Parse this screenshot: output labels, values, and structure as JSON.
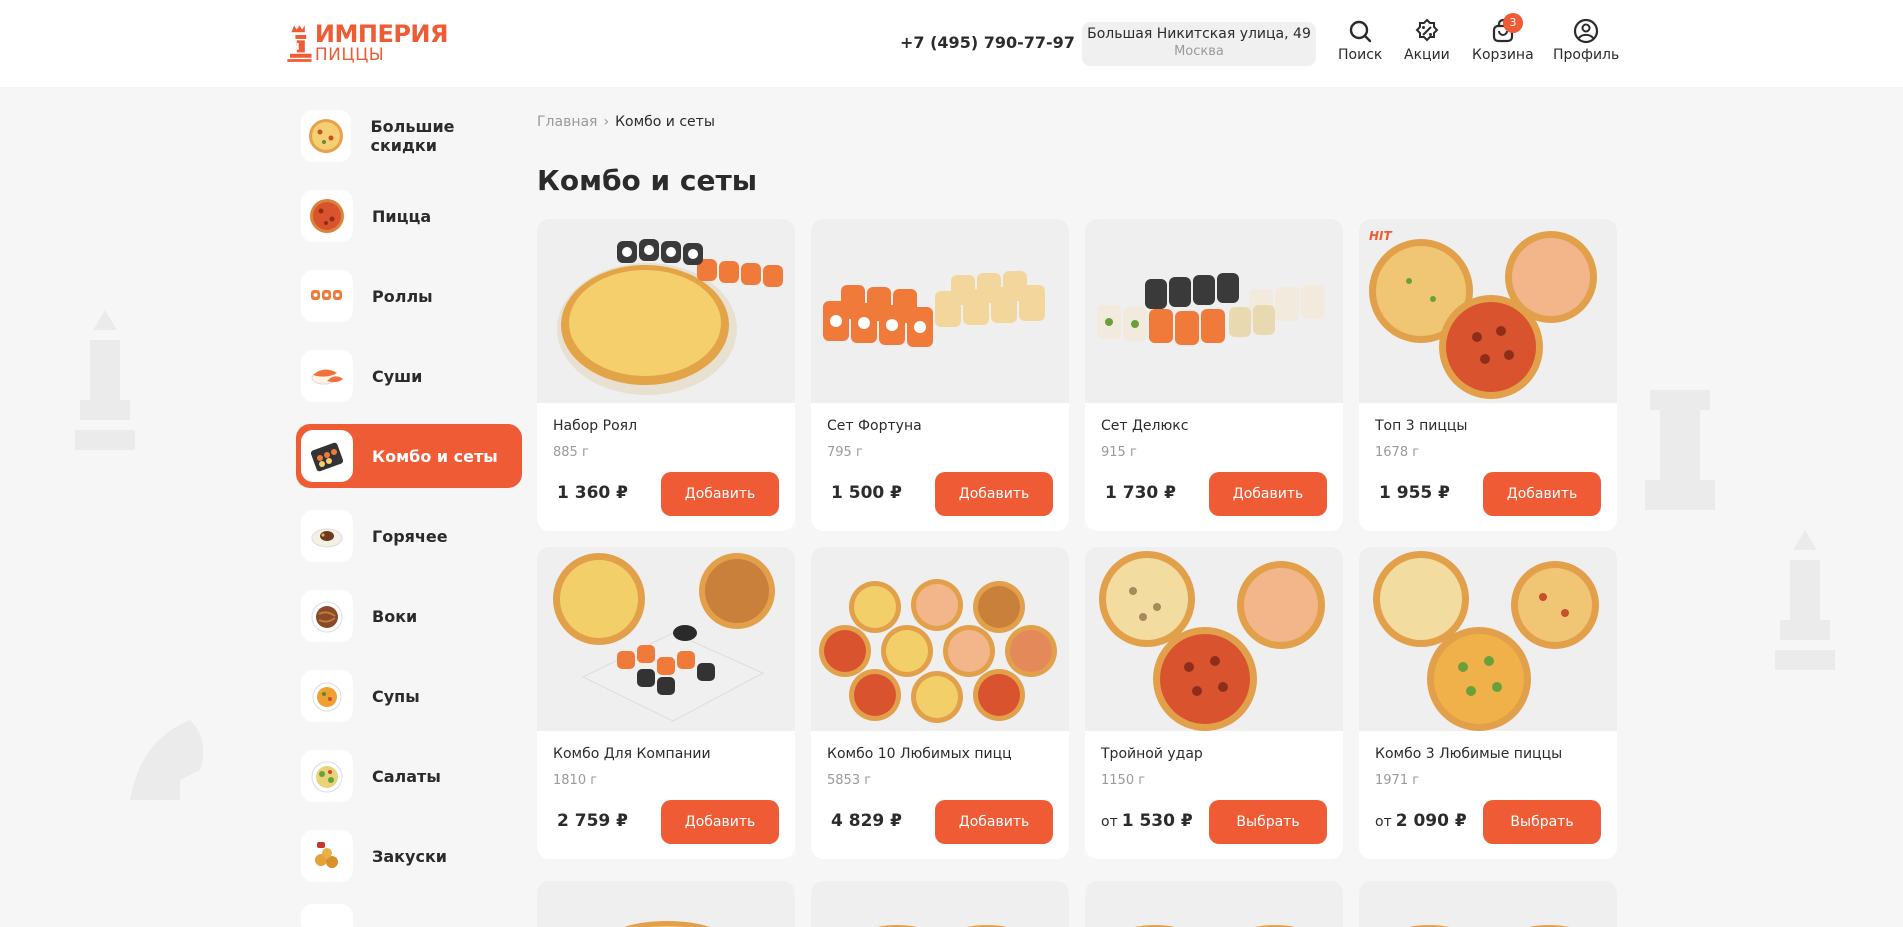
{
  "header": {
    "logo": {
      "main": "ИМПЕРИЯ",
      "sub": "ПИЦЦЫ"
    },
    "phone": "+7 (495) 790-77-97",
    "address": {
      "street": "Большая Никитская улица, 49",
      "city": "Москва"
    },
    "nav": {
      "search": "Поиск",
      "promos": "Акции",
      "cart": "Корзина",
      "cart_count": "3",
      "profile": "Профиль"
    }
  },
  "sidebar": {
    "items": [
      {
        "label": "Большие скидки",
        "icon": "pizza-icon"
      },
      {
        "label": "Пицца",
        "icon": "pizza-icon"
      },
      {
        "label": "Роллы",
        "icon": "rolls-icon"
      },
      {
        "label": "Суши",
        "icon": "sushi-icon"
      },
      {
        "label": "Комбо и сеты",
        "icon": "combo-icon",
        "active": true
      },
      {
        "label": "Горячее",
        "icon": "hot-dish-icon"
      },
      {
        "label": "Воки",
        "icon": "wok-icon"
      },
      {
        "label": "Супы",
        "icon": "soup-icon"
      },
      {
        "label": "Салаты",
        "icon": "salad-icon"
      },
      {
        "label": "Закуски",
        "icon": "snacks-icon"
      }
    ]
  },
  "breadcrumb": {
    "home": "Главная",
    "current": "Комбо и сеты"
  },
  "page_title": "Комбо и сеты",
  "products": [
    {
      "name": "Набор Роял",
      "weight": "885 г",
      "price_prefix": "",
      "price": "1 360 ₽",
      "button": "Добавить",
      "image": "pizza-and-rolls"
    },
    {
      "name": "Сет Фортуна",
      "weight": "795 г",
      "price_prefix": "",
      "price": "1 500 ₽",
      "button": "Добавить",
      "image": "rolls-set"
    },
    {
      "name": "Сет Делюкс",
      "weight": "915 г",
      "price_prefix": "",
      "price": "1 730 ₽",
      "button": "Добавить",
      "image": "rolls-set"
    },
    {
      "name": "Топ 3 пиццы",
      "weight": "1678 г",
      "price_prefix": "",
      "price": "1 955 ₽",
      "button": "Добавить",
      "image": "three-pizzas",
      "badge": "HIT"
    },
    {
      "name": "Комбо Для Компании",
      "weight": "1810 г",
      "price_prefix": "",
      "price": "2 759 ₽",
      "button": "Добавить",
      "image": "pizzas-and-rolls"
    },
    {
      "name": "Комбо 10 Любимых пицц",
      "weight": "5853 г",
      "price_prefix": "",
      "price": "4 829 ₽",
      "button": "Добавить",
      "image": "ten-pizzas"
    },
    {
      "name": "Тройной удар",
      "weight": "1150 г",
      "price_prefix": "от",
      "price": "1 530 ₽",
      "button": "Выбрать",
      "image": "three-pizzas"
    },
    {
      "name": "Комбо 3 Любимые пиццы",
      "weight": "1971 г",
      "price_prefix": "от",
      "price": "2 090 ₽",
      "button": "Выбрать",
      "image": "three-pizzas"
    }
  ],
  "colors": {
    "accent": "#ee5b34",
    "background": "#f6f6f6",
    "text": "#2b2b2b",
    "muted": "#9a9a9a"
  }
}
